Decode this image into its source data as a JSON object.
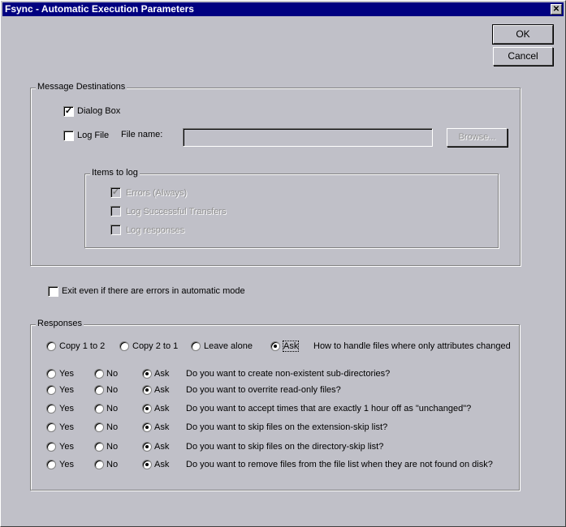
{
  "window": {
    "title": "Fsync - Automatic Execution Parameters",
    "close": "✕"
  },
  "buttons": {
    "ok": "OK",
    "cancel": "Cancel",
    "browse": "Browse..."
  },
  "message_destinations": {
    "label": "Message Destinations",
    "dialog_box": {
      "label": "Dialog Box",
      "checked": true
    },
    "log_file": {
      "label": "Log File",
      "checked": false
    },
    "file_name_label": "File name:",
    "file_name_value": "",
    "items_to_log": {
      "label": "Items to log",
      "items": [
        {
          "label": "Errors (Always)",
          "checked": true
        },
        {
          "label": "Log Successful Transfers",
          "checked": false
        },
        {
          "label": "Log responses",
          "checked": false
        }
      ]
    }
  },
  "exit_on_errors": {
    "label": "Exit even if there are errors in automatic mode",
    "checked": false
  },
  "responses": {
    "label": "Responses",
    "attributes_row": {
      "options": [
        "Copy 1 to 2",
        "Copy 2 to 1",
        "Leave alone",
        "Ask"
      ],
      "selected": "Ask",
      "question": "How to handle files where only attributes changed"
    },
    "options": [
      "Yes",
      "No",
      "Ask"
    ],
    "rows": [
      {
        "question": "Do you want to create non-existent sub-directories?",
        "selected": "Ask"
      },
      {
        "question": "Do you want to overrite read-only files?",
        "selected": "Ask"
      },
      {
        "question": "Do you want to accept times that are exactly 1 hour off as \"unchanged\"?",
        "selected": "Ask"
      },
      {
        "question": "Do you want to skip files on the extension-skip list?",
        "selected": "Ask"
      },
      {
        "question": "Do you want to skip files on the directory-skip list?",
        "selected": "Ask"
      },
      {
        "question": "Do you want to remove files from the file list when they are not found on disk?",
        "selected": "Ask"
      }
    ]
  }
}
